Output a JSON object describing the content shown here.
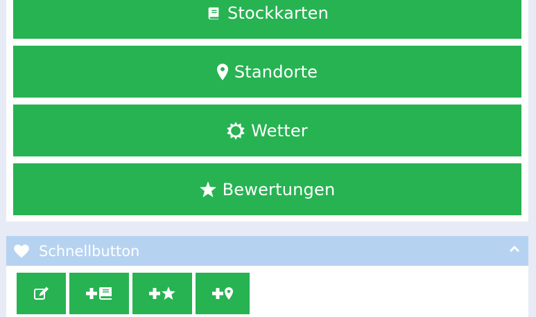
{
  "menu": {
    "stockkarten": {
      "label": "Stockkarten",
      "icon": "book-icon"
    },
    "standorte": {
      "label": "Standorte",
      "icon": "map-marker-icon"
    },
    "wetter": {
      "label": "Wetter",
      "icon": "sun-icon"
    },
    "bewertungen": {
      "label": "Bewertungen",
      "icon": "star-icon"
    }
  },
  "quick_section": {
    "title": "Schnellbutton",
    "icon": "heart-icon",
    "toggle_icon": "chevron-up-icon",
    "buttons": [
      {
        "icon": "edit-icon"
      },
      {
        "icon": "plus-book-icon"
      },
      {
        "icon": "plus-star-icon"
      },
      {
        "icon": "plus-map-marker-icon"
      }
    ]
  },
  "colors": {
    "button_green": "#27b352",
    "header_blue": "#b6d2f1",
    "page_background": "#e6ebf5",
    "text": "#ffffff"
  }
}
